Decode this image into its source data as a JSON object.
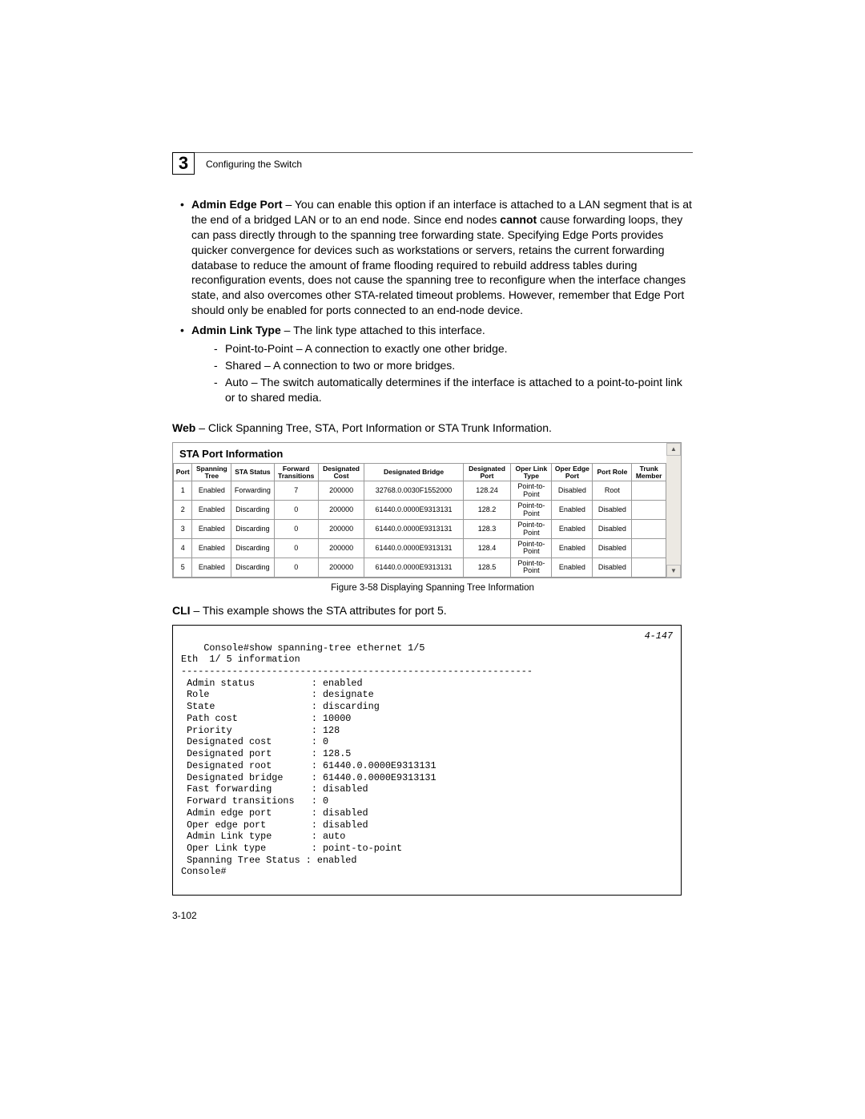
{
  "chapter": {
    "num": "3",
    "title": "Configuring the Switch"
  },
  "bullets": {
    "adminEdge": {
      "label": "Admin Edge Port",
      "text": " – You can enable this option if an interface is attached to a LAN segment that is at the end of a bridged LAN or to an end node. Since end nodes ",
      "bold2": "cannot",
      "text2": " cause forwarding loops, they can pass directly through to the spanning tree forwarding state. Specifying Edge Ports provides quicker convergence for devices such as workstations or servers, retains the current forwarding database to reduce the amount of frame flooding required to rebuild address tables during reconfiguration events, does not cause the spanning tree to reconfigure when the interface changes state, and also overcomes other STA-related timeout problems. However, remember that Edge Port should only be enabled for ports connected to an end-node device."
    },
    "adminLink": {
      "label": "Admin Link Type",
      "text": " – The link type attached to this interface.",
      "subs": [
        "Point-to-Point – A connection to exactly one other bridge.",
        "Shared – A connection to two or more bridges.",
        "Auto – The switch automatically determines if the interface is attached to a point-to-point link or to shared media."
      ]
    }
  },
  "web": {
    "label": "Web",
    "text": " – Click Spanning Tree, STA, Port Information or STA Trunk Information."
  },
  "sta": {
    "title": "STA Port Information",
    "headers": [
      "Port",
      "Spanning Tree",
      "STA Status",
      "Forward Transitions",
      "Designated Cost",
      "Designated Bridge",
      "Designated Port",
      "Oper Link Type",
      "Oper Edge Port",
      "Port Role",
      "Trunk Member"
    ],
    "rows": [
      [
        "1",
        "Enabled",
        "Forwarding",
        "7",
        "200000",
        "32768.0.0030F1552000",
        "128.24",
        "Point-to-Point",
        "Disabled",
        "Root",
        ""
      ],
      [
        "2",
        "Enabled",
        "Discarding",
        "0",
        "200000",
        "61440.0.0000E9313131",
        "128.2",
        "Point-to-Point",
        "Enabled",
        "Disabled",
        ""
      ],
      [
        "3",
        "Enabled",
        "Discarding",
        "0",
        "200000",
        "61440.0.0000E9313131",
        "128.3",
        "Point-to-Point",
        "Enabled",
        "Disabled",
        ""
      ],
      [
        "4",
        "Enabled",
        "Discarding",
        "0",
        "200000",
        "61440.0.0000E9313131",
        "128.4",
        "Point-to-Point",
        "Enabled",
        "Disabled",
        ""
      ],
      [
        "5",
        "Enabled",
        "Discarding",
        "0",
        "200000",
        "61440.0.0000E9313131",
        "128.5",
        "Point-to-Point",
        "Enabled",
        "Disabled",
        ""
      ]
    ]
  },
  "figureCaption": "Figure 3-58  Displaying Spanning Tree Information",
  "cli": {
    "label": "CLI",
    "text": " – This example shows the STA attributes for port 5.",
    "ref": "4-147",
    "body": "Console#show spanning-tree ethernet 1/5\nEth  1/ 5 information\n--------------------------------------------------------------\n Admin status          : enabled\n Role                  : designate\n State                 : discarding\n Path cost             : 10000\n Priority              : 128\n Designated cost       : 0\n Designated port       : 128.5\n Designated root       : 61440.0.0000E9313131\n Designated bridge     : 61440.0.0000E9313131\n Fast forwarding       : disabled\n Forward transitions   : 0\n Admin edge port       : disabled\n Oper edge port        : disabled\n Admin Link type       : auto\n Oper Link type        : point-to-point\n Spanning Tree Status : enabled\nConsole#"
  },
  "pageNum": "3-102"
}
